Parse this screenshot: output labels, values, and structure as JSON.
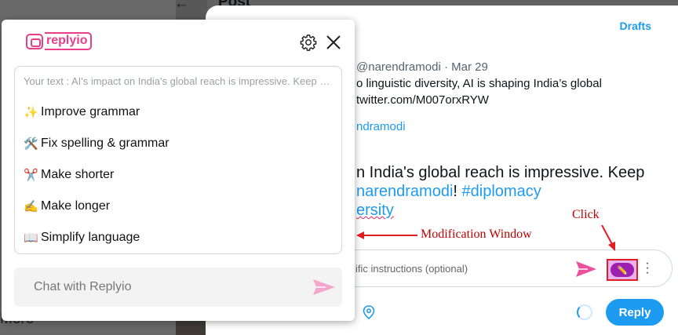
{
  "background": {
    "more_label": "More",
    "back_icon": "arrow-left-icon",
    "post_title": "Post"
  },
  "compose": {
    "drafts_label": "Drafts",
    "tweet_meta": "@narendramodi · Mar 29",
    "tweet_line1": "o linguistic diversity, AI is shaping India’s global",
    "tweet_line2": "twitter.com/M007orxRYW",
    "reply_to_handle": "ndramodi",
    "draft_line1": "n India's global reach is impressive. Keep",
    "draft_mention": "narendramodi",
    "draft_bang": "!",
    "draft_hashtag": "#diplomacy",
    "draft_line3": "ersity",
    "instructions_placeholder": "ific instructions (optional)",
    "reply_label": "Reply",
    "accent": "#1d9bf0"
  },
  "annotations": {
    "modification_window": "Modification Window",
    "click": "Click",
    "color": "#c00000"
  },
  "replyio": {
    "logo_text": "replyio",
    "brand_color": "#e83e8c",
    "your_text": "Your text : AI's impact on India's global reach is impressive. Keep up the great work @narendramodi! #diplomacy #diversity",
    "options": [
      {
        "emoji": "✨",
        "label": "Improve grammar"
      },
      {
        "emoji": "🛠️",
        "label": "Fix spelling & grammar"
      },
      {
        "emoji": "✂️",
        "label": "Make shorter"
      },
      {
        "emoji": "✍️",
        "label": "Make longer"
      },
      {
        "emoji": "📖",
        "label": "Simplify language"
      }
    ],
    "chat_placeholder": "Chat with Replyio"
  }
}
